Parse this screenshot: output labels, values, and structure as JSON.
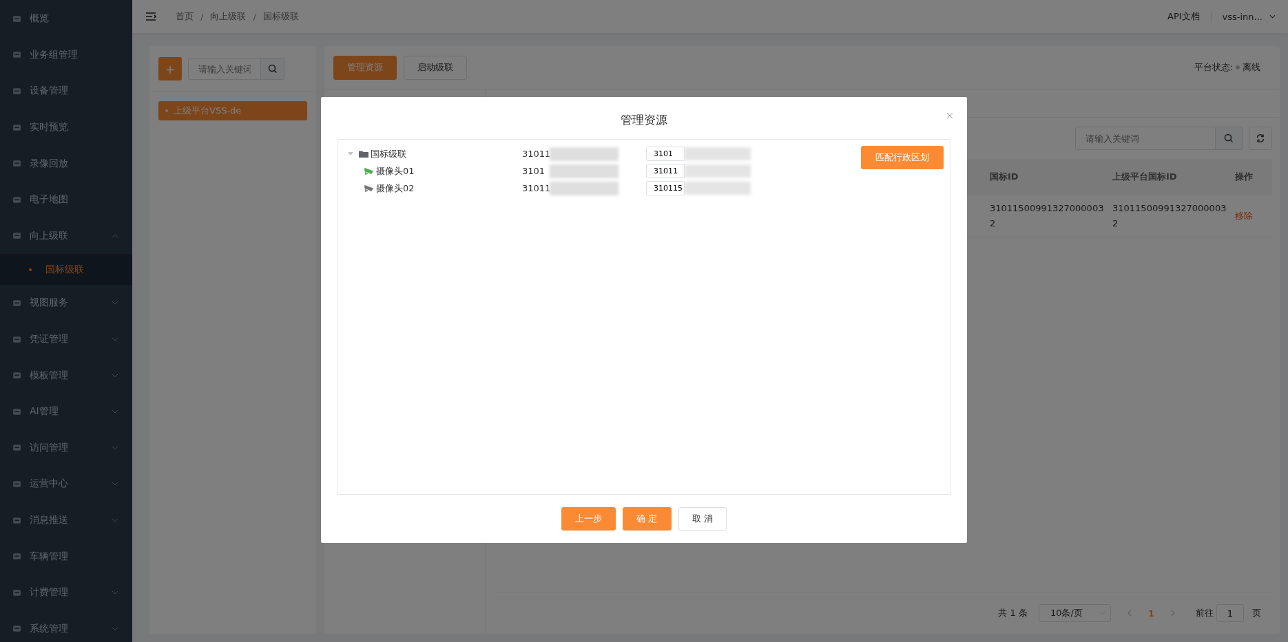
{
  "sidebar": {
    "items": [
      {
        "label": "概览",
        "kind": "link"
      },
      {
        "label": "业务组管理",
        "kind": "link"
      },
      {
        "label": "设备管理",
        "kind": "link"
      },
      {
        "label": "实时预览",
        "kind": "link"
      },
      {
        "label": "录像回放",
        "kind": "link"
      },
      {
        "label": "电子地图",
        "kind": "link"
      },
      {
        "label": "向上级联",
        "kind": "group",
        "expanded": true,
        "children": [
          {
            "label": "国标级联",
            "selected": true
          }
        ]
      },
      {
        "label": "视图服务",
        "kind": "group",
        "expanded": false
      },
      {
        "label": "凭证管理",
        "kind": "group",
        "expanded": false
      },
      {
        "label": "模板管理",
        "kind": "group",
        "expanded": false
      },
      {
        "label": "AI管理",
        "kind": "group",
        "expanded": false
      },
      {
        "label": "访问管理",
        "kind": "group",
        "expanded": false
      },
      {
        "label": "运营中心",
        "kind": "group",
        "expanded": false
      },
      {
        "label": "消息推送",
        "kind": "group",
        "expanded": false
      },
      {
        "label": "车辆管理",
        "kind": "link"
      },
      {
        "label": "计费管理",
        "kind": "group",
        "expanded": false
      },
      {
        "label": "系统管理",
        "kind": "group",
        "expanded": false
      }
    ]
  },
  "header": {
    "breadcrumb": [
      "首页",
      "向上级联",
      "国标级联"
    ],
    "breadcrumb_separator": "/",
    "api_docs": "API文档",
    "user": "vss-inn..."
  },
  "platform_panel": {
    "add_button": "+",
    "search": {
      "placeholder": "请输入关键词"
    },
    "platforms": [
      {
        "label": "上级平台VSS-de",
        "selected": true
      }
    ]
  },
  "main_panel": {
    "buttons": [
      {
        "label": "管理资源",
        "kind": "primary"
      },
      {
        "label": "启动级联",
        "kind": "default"
      }
    ],
    "status_label": "平台状态:",
    "status": "离线",
    "online": false,
    "search": {
      "placeholder": "请输入关键词"
    },
    "table": {
      "columns": [
        "国标ID",
        "上级平台国标ID",
        "操作"
      ],
      "rows": [
        {
          "cells": [
            "310115009913270000032",
            "310115009913270000032"
          ],
          "action": "移除"
        }
      ]
    },
    "pagination": {
      "total": "共 1 条",
      "page_size": "10条/页",
      "pages": [
        {
          "label": "1",
          "selected": true
        }
      ],
      "goto_label": "前往",
      "goto_value": "1",
      "page_unit": "页"
    }
  },
  "modal": {
    "title": "管理资源",
    "match_button": "匹配行政区划",
    "tree": [
      {
        "label": "国标级联",
        "kind": "folder",
        "expanded": true,
        "id": "31011",
        "id_value": "3101",
        "children": [
          {
            "label": "摄像头01",
            "kind": "camera",
            "online": true,
            "id": "3101",
            "id_value": "31011"
          },
          {
            "label": "摄像头02",
            "kind": "camera",
            "online": false,
            "id": "31011",
            "id_value": "310115"
          }
        ]
      }
    ],
    "buttons": [
      {
        "label": "上一步",
        "kind": "primary"
      },
      {
        "label": "确 定",
        "kind": "primary"
      },
      {
        "label": "取 消",
        "kind": "default"
      }
    ]
  }
}
